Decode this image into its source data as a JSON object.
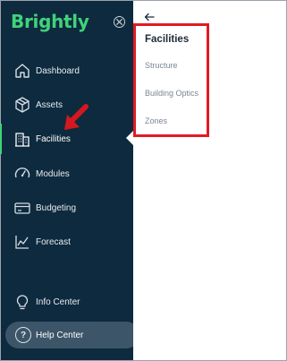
{
  "brand": {
    "name": "Brightly",
    "accent": "#3fd37a"
  },
  "sidebar": {
    "background": "#0e2a3e",
    "items": [
      {
        "label": "Dashboard",
        "icon": "house-icon",
        "active": false
      },
      {
        "label": "Assets",
        "icon": "cube-icon",
        "active": false
      },
      {
        "label": "Facilities",
        "icon": "building-icon",
        "active": true
      },
      {
        "label": "Modules",
        "icon": "gauge-icon",
        "active": false
      },
      {
        "label": "Budgeting",
        "icon": "card-icon",
        "active": false
      },
      {
        "label": "Forecast",
        "icon": "chart-icon",
        "active": false
      }
    ],
    "info_center": {
      "label": "Info Center",
      "icon": "lightbulb-icon"
    },
    "help_center": {
      "label": "Help Center",
      "icon": "question-icon"
    }
  },
  "panel": {
    "back_icon": "arrow-left-icon",
    "title": "Facilities",
    "items": [
      {
        "label": "Structure"
      },
      {
        "label": "Building Optics"
      },
      {
        "label": "Zones"
      }
    ]
  },
  "annotation": {
    "highlight_color": "#e11b22"
  }
}
